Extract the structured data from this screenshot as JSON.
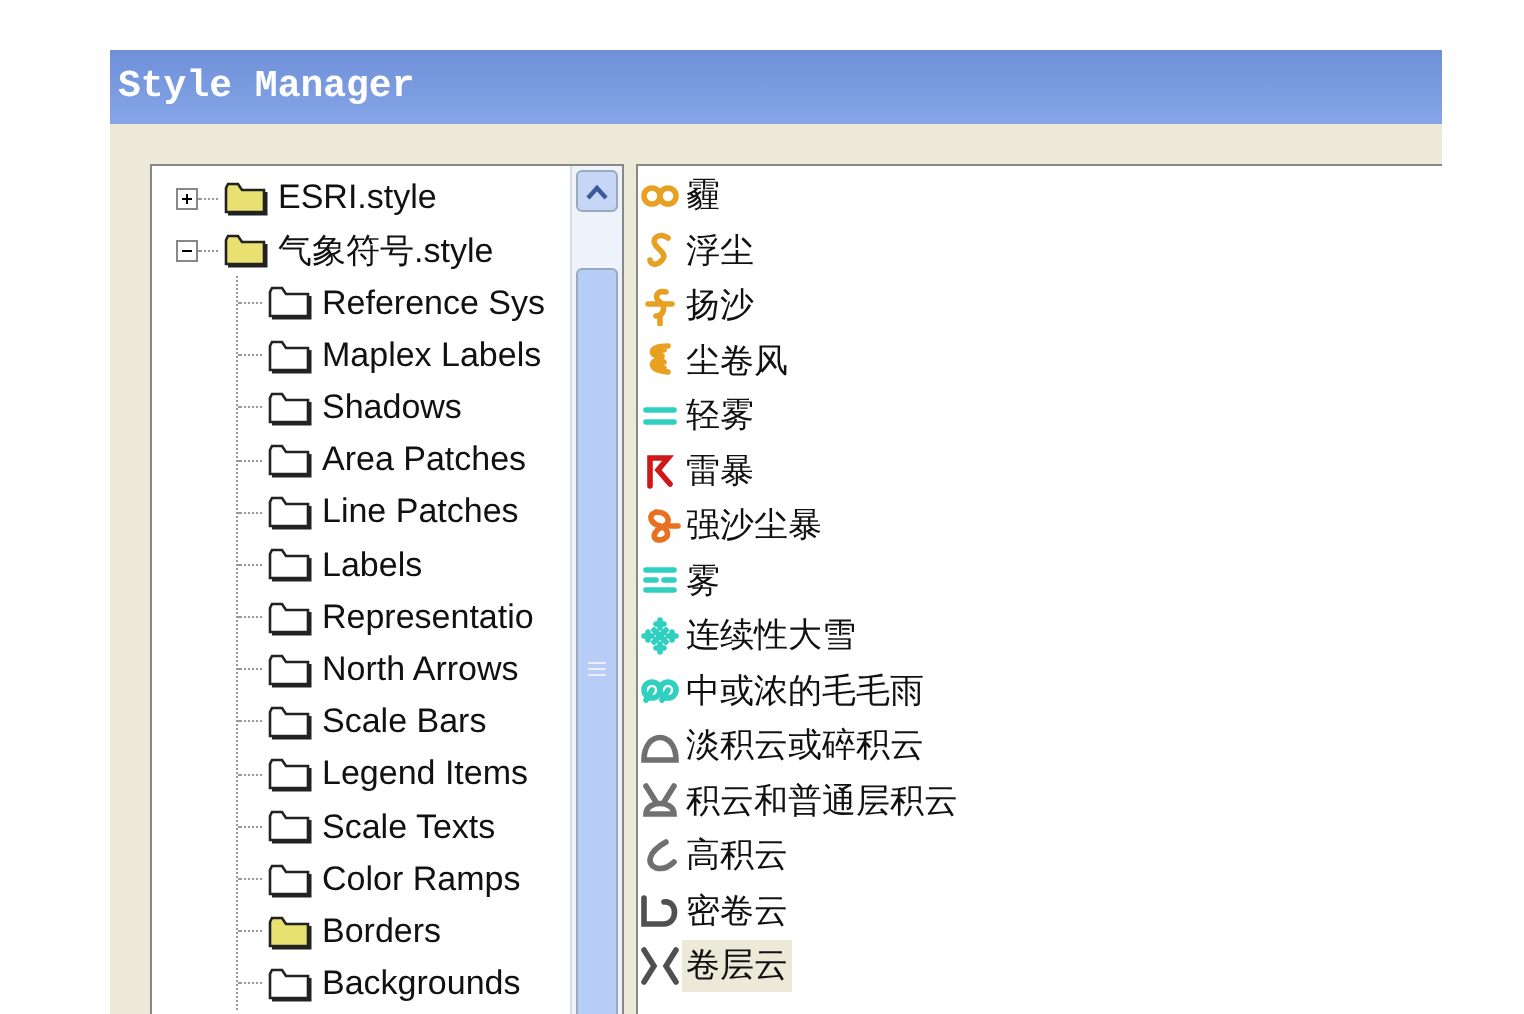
{
  "window": {
    "title": "Style Manager"
  },
  "tree": [
    {
      "label": "ESRI.style",
      "expanded": false,
      "filled": true
    },
    {
      "label": "气象符号.style",
      "expanded": true,
      "filled": true,
      "children": [
        {
          "label": "Reference Sys",
          "filled": false
        },
        {
          "label": "Maplex Labels",
          "filled": false
        },
        {
          "label": "Shadows",
          "filled": false
        },
        {
          "label": "Area Patches",
          "filled": false
        },
        {
          "label": "Line Patches",
          "filled": false
        },
        {
          "label": "Labels",
          "filled": false
        },
        {
          "label": "Representatio",
          "filled": false
        },
        {
          "label": "North Arrows",
          "filled": false
        },
        {
          "label": "Scale Bars",
          "filled": false
        },
        {
          "label": "Legend Items",
          "filled": false
        },
        {
          "label": "Scale Texts",
          "filled": false
        },
        {
          "label": "Color Ramps",
          "filled": false
        },
        {
          "label": "Borders",
          "filled": true
        },
        {
          "label": "Backgrounds",
          "filled": false
        }
      ]
    }
  ],
  "symbols": [
    {
      "label": "霾",
      "kind": "haze",
      "color": "#e8a020",
      "selected": false
    },
    {
      "label": "浮尘",
      "kind": "dust",
      "color": "#e8a020",
      "selected": false
    },
    {
      "label": "扬沙",
      "kind": "sand",
      "color": "#e8a020",
      "selected": false
    },
    {
      "label": "尘卷风",
      "kind": "whirl",
      "color": "#e8a020",
      "selected": false
    },
    {
      "label": "轻雾",
      "kind": "mist",
      "color": "#30d0c0",
      "selected": false
    },
    {
      "label": "雷暴",
      "kind": "thunder",
      "color": "#d01818",
      "selected": false
    },
    {
      "label": "强沙尘暴",
      "kind": "sandstorm",
      "color": "#e87020",
      "selected": false
    },
    {
      "label": "雾",
      "kind": "fog",
      "color": "#30d0c0",
      "selected": false
    },
    {
      "label": "连续性大雪",
      "kind": "snow",
      "color": "#30d0c0",
      "selected": false
    },
    {
      "label": "中或浓的毛毛雨",
      "kind": "drizzle",
      "color": "#30d0c0",
      "selected": false
    },
    {
      "label": "淡积云或碎积云",
      "kind": "dome",
      "color": "#707070",
      "selected": false
    },
    {
      "label": "积云和普通层积云",
      "kind": "tower",
      "color": "#707070",
      "selected": false
    },
    {
      "label": "高积云",
      "kind": "alto",
      "color": "#707070",
      "selected": false
    },
    {
      "label": "密卷云",
      "kind": "cirrus",
      "color": "#505050",
      "selected": false
    },
    {
      "label": "卷层云",
      "kind": "cirrostratus",
      "color": "#505050",
      "selected": true
    }
  ]
}
